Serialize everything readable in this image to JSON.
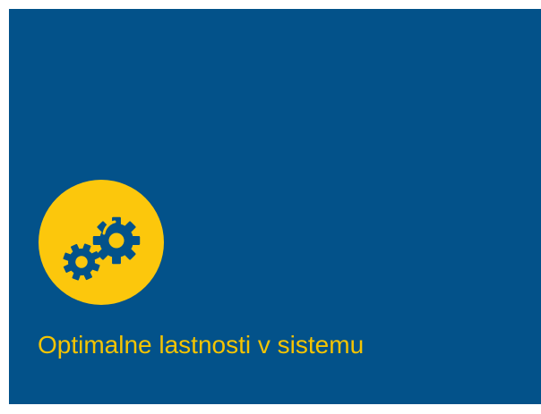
{
  "card": {
    "title": "Optimalne lastnosti v sistemu",
    "icon": "gears-icon",
    "colors": {
      "background": "#03528a",
      "badge": "#fcc70c",
      "title": "#f5c400",
      "icon": "#03528a"
    }
  }
}
